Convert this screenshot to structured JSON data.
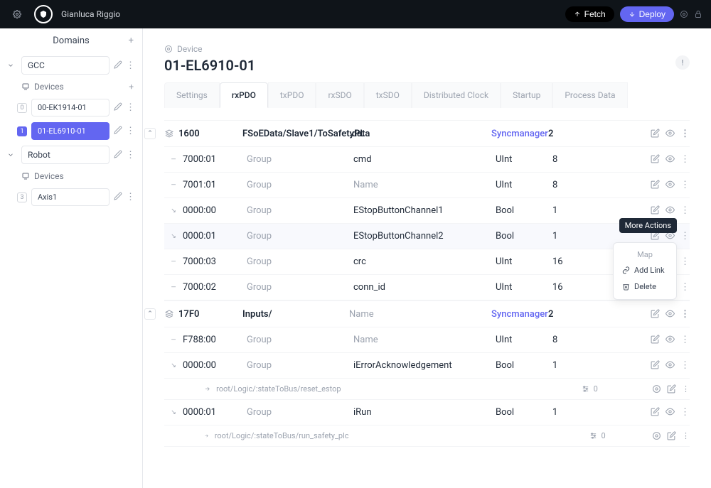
{
  "header": {
    "username": "Gianluca Riggio",
    "fetch_label": "Fetch",
    "deploy_label": "Deploy"
  },
  "sidebar": {
    "domains_label": "Domains",
    "devices_label": "Devices",
    "domains": [
      {
        "name": "GCC",
        "devices": [
          {
            "idx": "0",
            "name": "00-EK1914-01",
            "active": false
          },
          {
            "idx": "1",
            "name": "01-EL6910-01",
            "active": true
          }
        ]
      },
      {
        "name": "Robot",
        "devices": [
          {
            "idx": "3",
            "name": "Axis1",
            "active": false
          }
        ]
      }
    ]
  },
  "page": {
    "breadcrumb": "Device",
    "title": "01-EL6910-01",
    "info_badge": "!"
  },
  "tabs": [
    {
      "label": "Settings",
      "active": false
    },
    {
      "label": "rxPDO",
      "active": true
    },
    {
      "label": "txPDO",
      "active": false
    },
    {
      "label": "rxSDO",
      "active": false
    },
    {
      "label": "txSDO",
      "active": false
    },
    {
      "label": "Distributed Clock",
      "active": false
    },
    {
      "label": "Startup",
      "active": false
    },
    {
      "label": "Process Data",
      "active": false
    }
  ],
  "groups": [
    {
      "id": "1600",
      "path": "FSoEData/Slave1/ToSafetyPL",
      "name_col": ".data",
      "sync_label": "Syncmanager",
      "sync_val": "2",
      "rows": [
        {
          "idx": "7000:01",
          "group": "Group",
          "name": "cmd",
          "type": "UInt",
          "sm": "8",
          "arrow": "—"
        },
        {
          "idx": "7001:01",
          "group": "Group",
          "name": "Name",
          "name_muted": true,
          "type": "UInt",
          "sm": "8",
          "arrow": "—"
        },
        {
          "idx": "0000:00",
          "group": "Group",
          "name": "EStopButtonChannel1",
          "type": "Bool",
          "sm": "1",
          "arrow": "↘"
        },
        {
          "idx": "0000:01",
          "group": "Group",
          "name": "EStopButtonChannel2",
          "type": "Bool",
          "sm": "1",
          "arrow": "↘",
          "highlight": true,
          "popover": true
        },
        {
          "idx": "7000:03",
          "group": "Group",
          "name": "crc",
          "type": "UInt",
          "sm": "16",
          "arrow": "—"
        },
        {
          "idx": "7000:02",
          "group": "Group",
          "name": "conn_id",
          "type": "UInt",
          "sm": "16",
          "arrow": "—"
        }
      ]
    },
    {
      "id": "17F0",
      "path": "Inputs/",
      "name_col": "Name",
      "name_muted": true,
      "sync_label": "Syncmanager",
      "sync_val": "2",
      "rows": [
        {
          "idx": "F788:00",
          "group": "Group",
          "name": "Name",
          "name_muted": true,
          "type": "UInt",
          "sm": "8",
          "arrow": "—"
        },
        {
          "idx": "0000:00",
          "group": "Group",
          "name": "iErrorAcknowledgement",
          "type": "Bool",
          "sm": "1",
          "arrow": "↘",
          "link": {
            "path": "root/Logic/:stateToBus/reset_estop",
            "val": "0"
          }
        },
        {
          "idx": "0000:01",
          "group": "Group",
          "name": "iRun",
          "type": "Bool",
          "sm": "1",
          "arrow": "↘",
          "link": {
            "path": "root/Logic/:stateToBus/run_safety_plc",
            "val": "0"
          }
        }
      ]
    }
  ],
  "tooltip": "More Actions",
  "popover": {
    "head": "Map",
    "add_link": "Add Link",
    "delete": "Delete"
  }
}
